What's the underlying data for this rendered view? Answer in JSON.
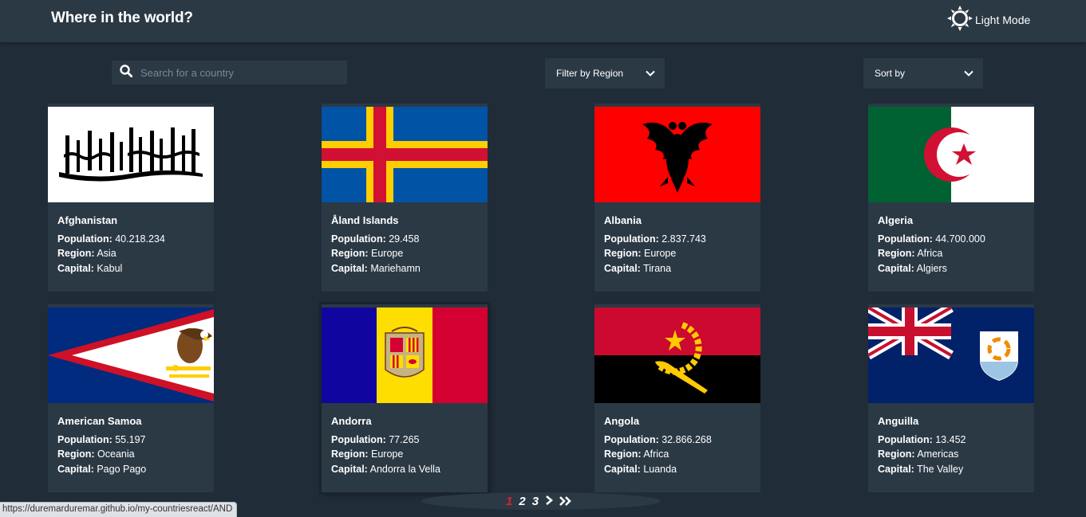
{
  "header": {
    "title": "Where in the world?",
    "mode_label": "Light Mode",
    "mode_icon": "sun-icon"
  },
  "search": {
    "placeholder": "Search for a country",
    "value": "",
    "icon": "search-icon"
  },
  "filter": {
    "label": "Filter by Region",
    "icon": "chevron-down-icon"
  },
  "sort": {
    "label": "Sort by",
    "icon": "chevron-down-icon"
  },
  "labels": {
    "population": "Population:",
    "region": "Region:",
    "capital": "Capital:"
  },
  "countries": [
    {
      "name": "Afghanistan",
      "population": "40.218.234",
      "region": "Asia",
      "capital": "Kabul"
    },
    {
      "name": "Åland Islands",
      "population": "29.458",
      "region": "Europe",
      "capital": "Mariehamn"
    },
    {
      "name": "Albania",
      "population": "2.837.743",
      "region": "Europe",
      "capital": "Tirana"
    },
    {
      "name": "Algeria",
      "population": "44.700.000",
      "region": "Africa",
      "capital": "Algiers"
    },
    {
      "name": "American Samoa",
      "population": "55.197",
      "region": "Oceania",
      "capital": "Pago Pago"
    },
    {
      "name": "Andorra",
      "population": "77.265",
      "region": "Europe",
      "capital": "Andorra la Vella"
    },
    {
      "name": "Angola",
      "population": "32.866.268",
      "region": "Africa",
      "capital": "Luanda"
    },
    {
      "name": "Anguilla",
      "population": "13.452",
      "region": "Americas",
      "capital": "The Valley"
    }
  ],
  "pagination": {
    "pages": [
      "1",
      "2",
      "3"
    ],
    "current": "1"
  },
  "status_bar": {
    "url": "https://duremarduremar.github.io/my-countriesreact/AND"
  },
  "colors": {
    "background": "#202c37",
    "surface": "#2b3945",
    "current_page": "#e0202a"
  }
}
